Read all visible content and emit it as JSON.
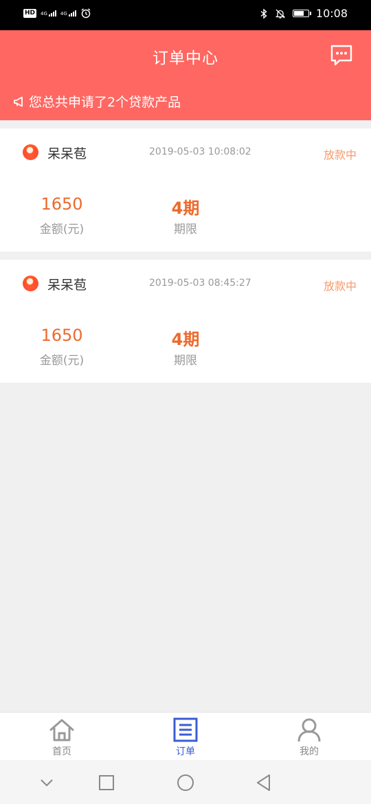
{
  "status_bar": {
    "hd": "HD",
    "network_1": "4G",
    "network_2": "4G",
    "time": "10:08",
    "battery_level": 0.75
  },
  "header": {
    "title": "订单中心",
    "notice": "您总共申请了2个贷款产品"
  },
  "orders": [
    {
      "product_name": "呆呆苞",
      "time": "2019-05-03 10:08:02",
      "status": "放款中",
      "amount": "1650",
      "amount_label": "金额(元)",
      "term": "4期",
      "term_label": "期限"
    },
    {
      "product_name": "呆呆苞",
      "time": "2019-05-03 08:45:27",
      "status": "放款中",
      "amount": "1650",
      "amount_label": "金额(元)",
      "term": "4期",
      "term_label": "期限"
    }
  ],
  "tabs": [
    {
      "label": "首页",
      "icon": "home-icon",
      "active": false
    },
    {
      "label": "订单",
      "icon": "order-list-icon",
      "active": true
    },
    {
      "label": "我的",
      "icon": "profile-icon",
      "active": false
    }
  ],
  "colors": {
    "brand": "#ff6762",
    "accent_orange": "#ec6a2c",
    "status_orange": "#f79a6a",
    "tab_active": "#3a5cd6",
    "tab_inactive": "#999999"
  }
}
